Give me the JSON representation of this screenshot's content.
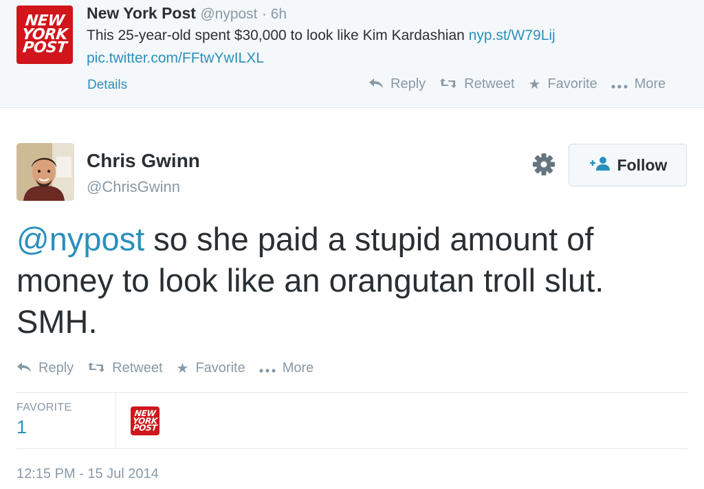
{
  "quoted_tweet": {
    "logo_text": [
      "NEW",
      "YORK",
      "POST"
    ],
    "author_name": "New York Post",
    "author_handle": "@nypost",
    "time": "· 6h",
    "text": "This 25-year-old spent $30,000 to look like Kim Kardashian",
    "link": "nyp.st/W79Lij",
    "pic_link": "pic.twitter.com/FFtwYwILXL",
    "details_label": "Details",
    "actions": {
      "reply": "Reply",
      "retweet": "Retweet",
      "favorite": "Favorite",
      "more": "More"
    }
  },
  "tweet": {
    "author_name": "Chris Gwinn",
    "author_handle": "@ChrisGwinn",
    "mention": "@nypost",
    "text": "so she paid a stupid amount of money to look like an orangutan troll slut. SMH.",
    "follow_label": "Follow",
    "actions": {
      "reply": "Reply",
      "retweet": "Retweet",
      "favorite": "Favorite",
      "more": "More"
    },
    "stats": {
      "favorite_label": "FAVORITE",
      "favorite_count": "1"
    },
    "timestamp": "12:15 PM - 15 Jul 2014"
  },
  "colors": {
    "link": "#2a8fbd",
    "muted": "#8899a6",
    "text": "#292f33",
    "nypost_red": "#d0151b",
    "header_bg": "#f5f8fa"
  }
}
